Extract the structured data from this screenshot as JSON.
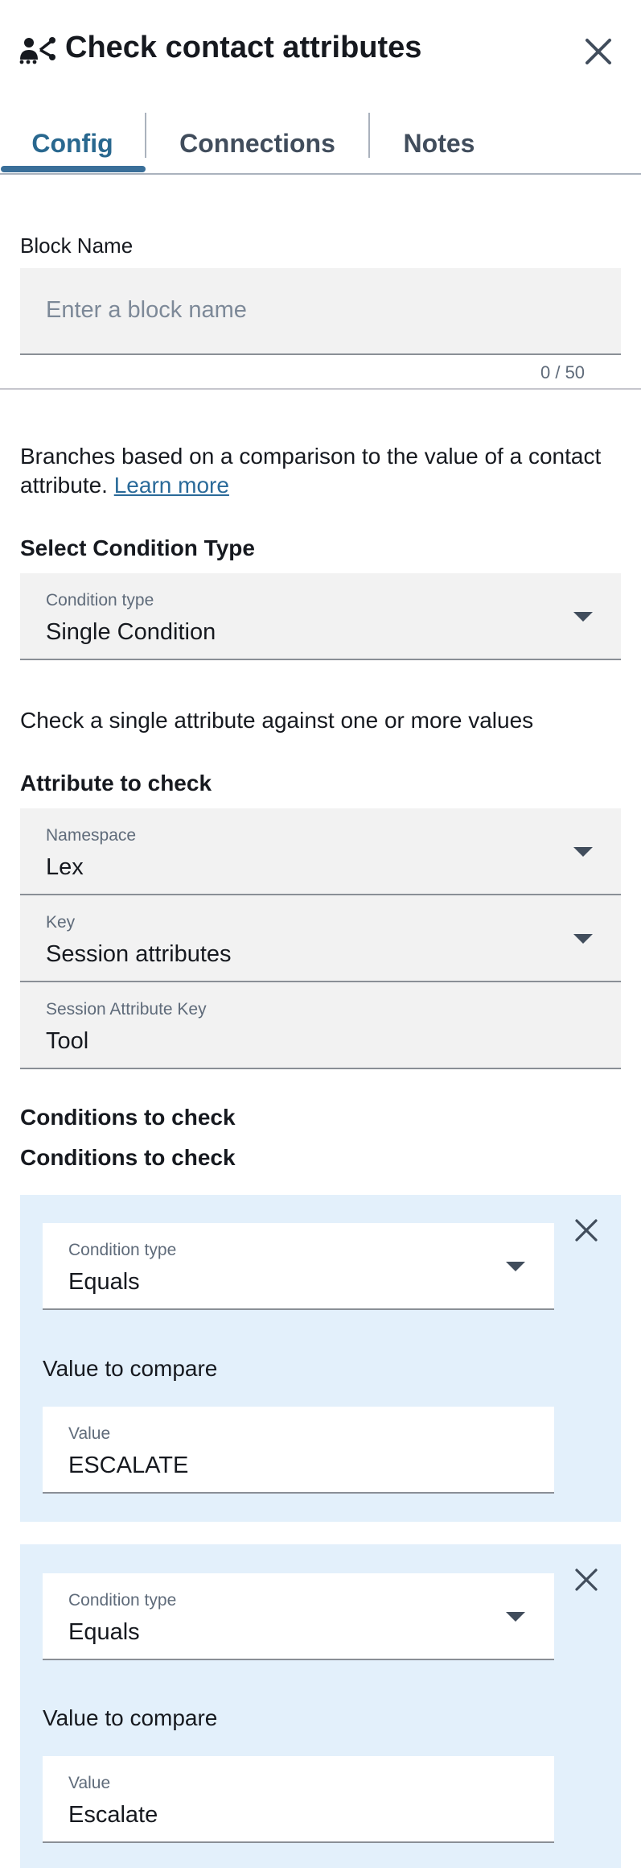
{
  "header": {
    "title": "Check contact attributes",
    "icon": "flow-block-icon",
    "close_icon": "close-icon"
  },
  "tabs": [
    {
      "label": "Config",
      "active": true
    },
    {
      "label": "Connections",
      "active": false
    },
    {
      "label": "Notes",
      "active": false
    }
  ],
  "block_name": {
    "label": "Block Name",
    "placeholder": "Enter a block name",
    "value": "",
    "counter": "0 / 50"
  },
  "description": {
    "text": "Branches based on a comparison to the value of a contact attribute.",
    "link": "Learn more"
  },
  "condition_type_section": {
    "heading": "Select Condition Type",
    "field_label": "Condition type",
    "value": "Single Condition"
  },
  "single_condition_help": "Check a single attribute against one or more values",
  "attribute_section": {
    "heading": "Attribute to check",
    "namespace": {
      "label": "Namespace",
      "value": "Lex"
    },
    "key": {
      "label": "Key",
      "value": "Session attributes"
    },
    "session_attribute_key": {
      "label": "Session Attribute Key",
      "value": "Tool"
    }
  },
  "conditions_section": {
    "heading_1": "Conditions to check",
    "heading_2": "Conditions to check",
    "conditions": [
      {
        "type_label": "Condition type",
        "type_value": "Equals",
        "compare_label": "Value to compare",
        "value_label": "Value",
        "value": "ESCALATE"
      },
      {
        "type_label": "Condition type",
        "type_value": "Equals",
        "compare_label": "Value to compare",
        "value_label": "Value",
        "value": "Escalate"
      }
    ]
  },
  "colors": {
    "accent": "#29688f",
    "field_bg": "#f2f2f2",
    "card_bg": "#e3f0fb",
    "text": "#16191f",
    "muted": "#5f6b7a"
  }
}
